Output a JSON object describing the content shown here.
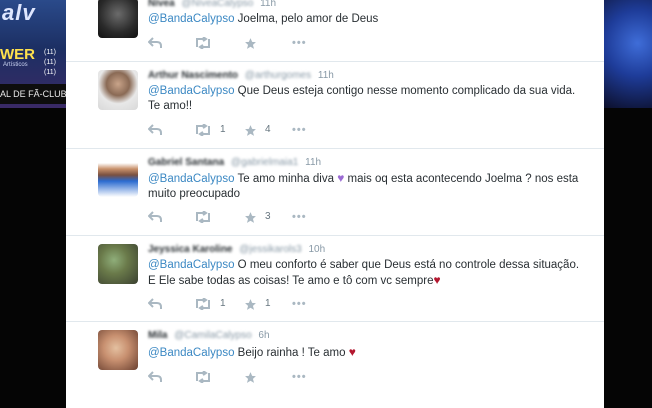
{
  "background": {
    "left_banner": {
      "title": "alv",
      "word": "WER",
      "subtitle": "Artísticos",
      "numbers": [
        "(11)",
        "(11)",
        "(11)"
      ],
      "footer": "AL DE FÃ-CLUBE"
    }
  },
  "colors": {
    "mention": "#3b88c3",
    "heart_purple": "#9b6bd3",
    "heart_red": "#b3172f"
  },
  "tweets": [
    {
      "name": "Nivea",
      "handle": "@NiveaCalypso",
      "time": "11h",
      "mention": "@BandaCalypso",
      "text": " Joelma, pelo amor de Deus",
      "retweets": "",
      "favorites": ""
    },
    {
      "name": "Arthur Nascimento",
      "handle": "@arthurgomes",
      "time": "11h",
      "mention": "@BandaCalypso",
      "text": " Que Deus esteja contigo nesse momento complicado da sua vida. Te amo!!",
      "retweets": "1",
      "favorites": "4"
    },
    {
      "name": "Gabriel Santana",
      "handle": "@gabrielmaia1",
      "time": "11h",
      "mention": "@BandaCalypso",
      "text": " Te amo minha diva",
      "text2": " mais oq esta acontecendo Joelma ? nos esta muito preocupado",
      "retweets": "",
      "favorites": "3"
    },
    {
      "name": "Jeyssica Karoline",
      "handle": "@jessikarols3",
      "time": "10h",
      "mention": "@BandaCalypso",
      "text": " O meu conforto é saber que Deus está no controle dessa situação. E Ele sabe todas as coisas! Te amo e tô com vc sempre",
      "retweets": "1",
      "favorites": "1"
    },
    {
      "name": "Mila",
      "handle": "@CamilaCalypso",
      "time": "6h",
      "mention": "@BandaCalypso",
      "text": " Beijo rainha ! Te amo ",
      "retweets": "",
      "favorites": ""
    }
  ],
  "icons": {
    "reply": "reply-icon",
    "retweet": "retweet-icon",
    "favorite": "star-icon",
    "more": "more-icon"
  }
}
